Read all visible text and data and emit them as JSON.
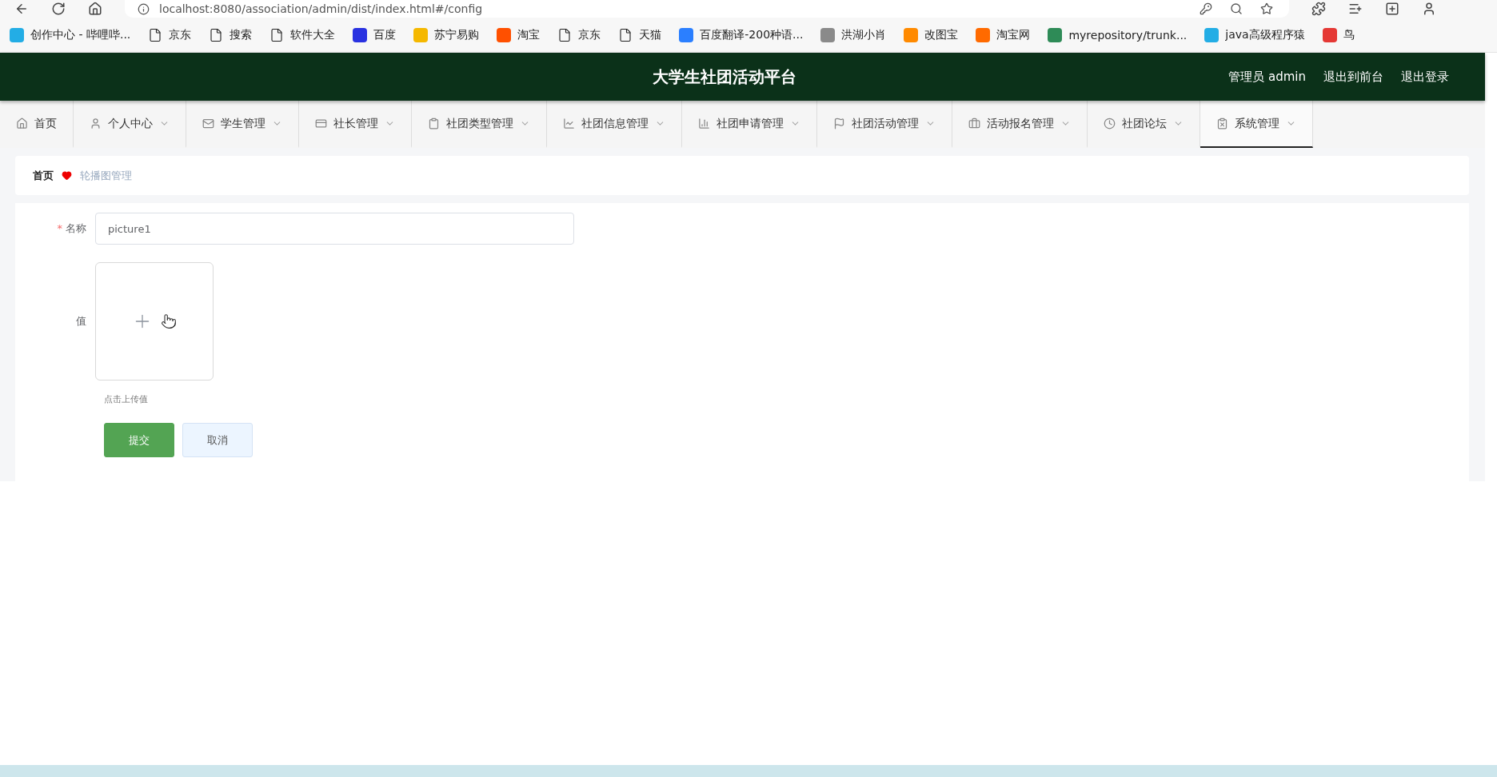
{
  "browser": {
    "address": "localhost:8080/association/admin/dist/index.html#/config",
    "bookmarks": [
      {
        "label": "创作中心 - 哔哩哔...",
        "kind": "site",
        "color": "#23ade5"
      },
      {
        "label": "京东",
        "kind": "page"
      },
      {
        "label": "搜索",
        "kind": "page"
      },
      {
        "label": "软件大全",
        "kind": "page"
      },
      {
        "label": "百度",
        "kind": "site",
        "color": "#2932e1"
      },
      {
        "label": "苏宁易购",
        "kind": "site",
        "color": "#f5b800"
      },
      {
        "label": "淘宝",
        "kind": "site",
        "color": "#ff5000"
      },
      {
        "label": "京东",
        "kind": "page"
      },
      {
        "label": "天猫",
        "kind": "page"
      },
      {
        "label": "百度翻译-200种语...",
        "kind": "site",
        "color": "#2b7fff"
      },
      {
        "label": "洪湖小肖",
        "kind": "site",
        "color": "#8a8a8a"
      },
      {
        "label": "改图宝",
        "kind": "site",
        "color": "#ff8a00"
      },
      {
        "label": "淘宝网",
        "kind": "site",
        "color": "#ff6a00"
      },
      {
        "label": "myrepository/trunk...",
        "kind": "site",
        "color": "#2e8b57"
      },
      {
        "label": "java高级程序猿",
        "kind": "site",
        "color": "#23ade5"
      },
      {
        "label": "鸟",
        "kind": "site",
        "color": "#e53935"
      }
    ]
  },
  "header": {
    "title": "大学生社团活动平台",
    "links": [
      "管理员 admin",
      "退出到前台",
      "退出登录"
    ]
  },
  "nav": [
    {
      "label": "首页",
      "dropdown": false,
      "selected": false
    },
    {
      "label": "个人中心",
      "dropdown": true,
      "selected": false
    },
    {
      "label": "学生管理",
      "dropdown": true,
      "selected": false
    },
    {
      "label": "社长管理",
      "dropdown": true,
      "selected": false
    },
    {
      "label": "社团类型管理",
      "dropdown": true,
      "selected": false
    },
    {
      "label": "社团信息管理",
      "dropdown": true,
      "selected": false
    },
    {
      "label": "社团申请管理",
      "dropdown": true,
      "selected": false
    },
    {
      "label": "社团活动管理",
      "dropdown": true,
      "selected": false
    },
    {
      "label": "活动报名管理",
      "dropdown": true,
      "selected": false
    },
    {
      "label": "社团论坛",
      "dropdown": true,
      "selected": false
    },
    {
      "label": "系统管理",
      "dropdown": true,
      "selected": true
    }
  ],
  "breadcrumb": {
    "home": "首页",
    "current": "轮播图管理"
  },
  "form": {
    "name_field": {
      "label": "名称",
      "required": true,
      "required_mark": "*",
      "value": "picture1"
    },
    "upload_field": {
      "label": "值",
      "hint": "点击上传值"
    },
    "buttons": [
      {
        "label": "提交",
        "kind": "primary"
      },
      {
        "label": "取消",
        "kind": "secondary"
      }
    ]
  }
}
